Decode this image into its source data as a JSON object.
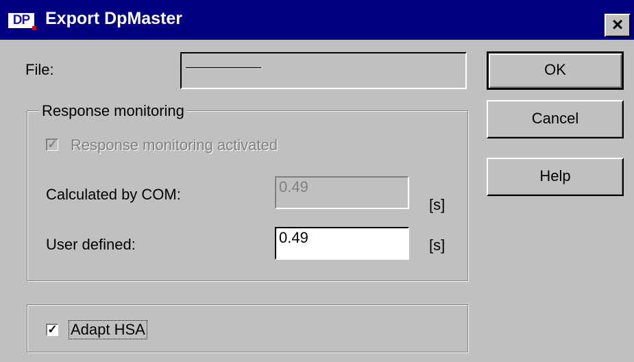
{
  "window": {
    "title": "Export DpMaster",
    "icon_text": "DP",
    "close_symbol": "×"
  },
  "file": {
    "label": "File:",
    "value": ""
  },
  "response_monitoring": {
    "group_label": "Response monitoring",
    "activated_label": "Response monitoring activated",
    "activated_checked": true,
    "calculated_label": "Calculated by COM:",
    "calculated_value": "0.49",
    "calculated_unit": "[s]",
    "user_label": "User defined:",
    "user_value": "0.49",
    "user_unit": "[s]"
  },
  "adapt_hsa": {
    "label": "Adapt HSA",
    "checked": true
  },
  "buttons": {
    "ok": "OK",
    "cancel": "Cancel",
    "help": "Help"
  },
  "checkmark": "✓"
}
